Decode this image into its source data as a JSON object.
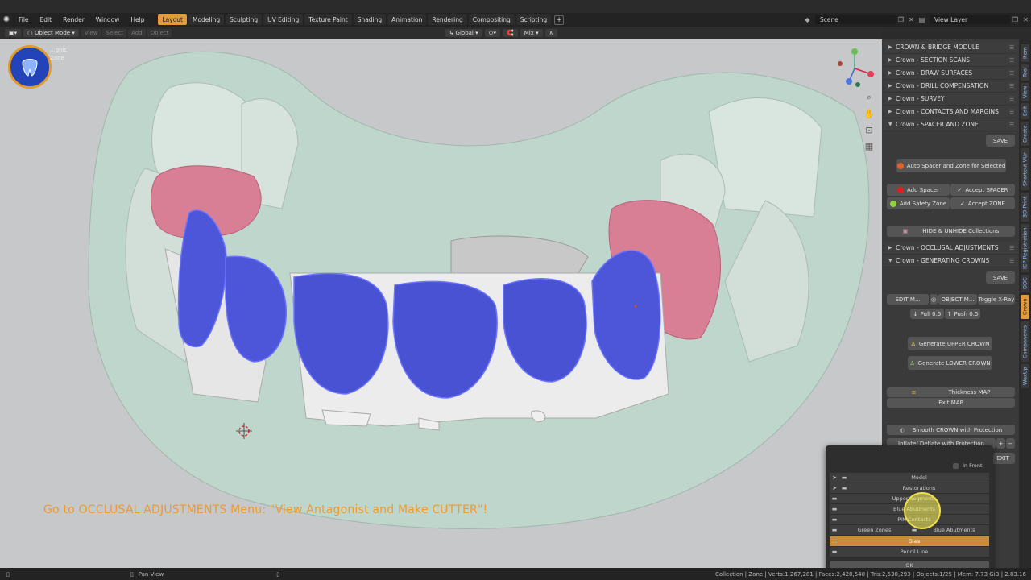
{
  "menu": {
    "items": [
      "File",
      "Edit",
      "Render",
      "Window",
      "Help"
    ]
  },
  "workspaces": [
    {
      "label": "Layout",
      "active": true
    },
    {
      "label": "Modeling"
    },
    {
      "label": "Sculpting"
    },
    {
      "label": "UV Editing"
    },
    {
      "label": "Texture Paint"
    },
    {
      "label": "Shading"
    },
    {
      "label": "Animation"
    },
    {
      "label": "Rendering"
    },
    {
      "label": "Compositing"
    },
    {
      "label": "Scripting"
    }
  ],
  "scene": {
    "name": "Scene",
    "view_layer": "View Layer"
  },
  "viewport_header": {
    "mode": "Object Mode",
    "view": "View",
    "select": "Select",
    "add": "Add",
    "object": "Object",
    "orientation": "Global",
    "pivot": "Mix"
  },
  "overlay_text": {
    "logo_line1": "...gnic",
    "logo_line2": "Zone",
    "instruction": "Go to OCCLUSAL ADJUSTMENTS Menu: \"View Antagonist and Make CUTTER\"!"
  },
  "sidebar": {
    "panels_top": [
      {
        "label": "CROWN & BRIDGE MODULE",
        "open": false
      },
      {
        "label": "Crown - SECTION SCANS",
        "open": false
      },
      {
        "label": "Crown - DRAW SURFACES",
        "open": false
      },
      {
        "label": "Crown - DRILL COMPENSATION",
        "open": false
      },
      {
        "label": "Crown - SURVEY",
        "open": false
      },
      {
        "label": "Crown - CONTACTS AND MARGINS",
        "open": false
      },
      {
        "label": "Crown - SPACER AND ZONE",
        "open": true
      }
    ],
    "save_label": "SAVE",
    "auto_spacer": "Auto Spacer and Zone for Selected",
    "add_spacer": "Add Spacer",
    "accept_spacer": "Accept SPACER",
    "add_safety": "Add Safety Zone",
    "accept_zone": "Accept ZONE",
    "hide_unhide": "HIDE & UNHIDE Collections",
    "panel_occlusal": "Crown - OCCLUSAL ADJUSTMENTS",
    "panel_generating": "Crown - GENERATING CROWNS",
    "save2": "SAVE",
    "edit_mode": "EDIT M...",
    "object_mode": "OBJECT M...",
    "toggle_xray": "Toggle X-Ray",
    "pull": "Pull 0.5",
    "push": "Push 0.5",
    "gen_upper": "Generate UPPER CROWN",
    "gen_lower": "Generate LOWER CROWN",
    "thickness": "Thickness MAP",
    "exit_map": "Exit MAP",
    "smooth": "Smooth CROWN with Protection",
    "inflate": "Inflate/ Deflate with Protection",
    "exit": "EXIT",
    "colors": {
      "orange_dot": "#e0622a",
      "red_dot": "#e02020",
      "green_dot": "#8cd43a"
    }
  },
  "vertical_tabs": [
    {
      "label": "Item"
    },
    {
      "label": "Tool"
    },
    {
      "label": "View"
    },
    {
      "label": "Edit"
    },
    {
      "label": "Create"
    },
    {
      "label": "Shortcut VUr"
    },
    {
      "label": "3D-Print"
    },
    {
      "label": "ICP Registration"
    },
    {
      "label": "ODC"
    },
    {
      "label": "Crown",
      "active": true
    },
    {
      "label": "Components"
    },
    {
      "label": "WaxUp"
    }
  ],
  "popup": {
    "in_front": "In Front",
    "rows": [
      "Model",
      "Restorations",
      "Upper Segments",
      "Blue Abutments",
      "PIN Contacts"
    ],
    "green_zones": "Green Zones",
    "blue_abutments": "Blue Abutments",
    "dies": "Dies",
    "pencil_line": "Pencil Line",
    "ok": "OK"
  },
  "statusbar": {
    "left": "Pan View",
    "right": "Collection | Zone | Verts:1,267,281 | Faces:2,428,540 | Tris:2,530,293 | Objects:1/25 | Mem: 7.73 GiB | 2.83.16"
  }
}
